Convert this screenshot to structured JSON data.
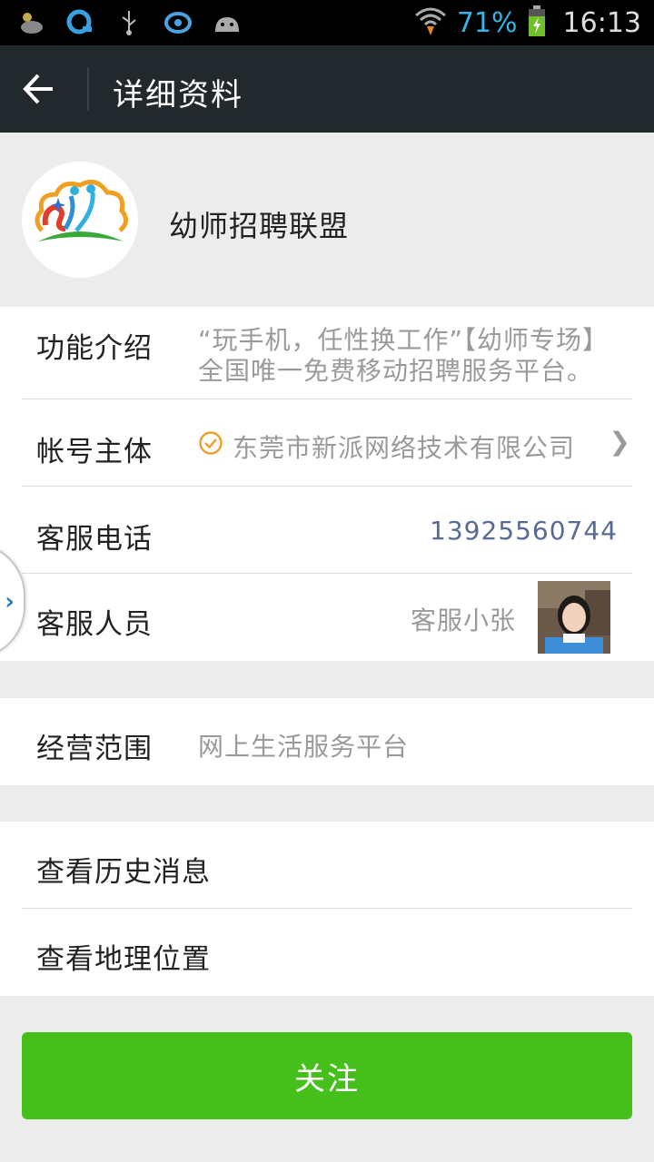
{
  "status_bar": {
    "icons": [
      "weather-icon",
      "q-app-icon",
      "usb-icon",
      "eye-app-icon",
      "android-icon",
      "wifi-icon",
      "battery-icon"
    ],
    "battery_percent": "71%",
    "time": "16:13",
    "battery_color": "#33b5e5"
  },
  "action_bar": {
    "title": "详细资料"
  },
  "profile": {
    "name": "幼师招聘联盟"
  },
  "details": {
    "intro_label": "功能介绍",
    "intro_value": "“玩手机，任性换工作”【幼师专场】全国唯一免费移动招聘服务平台。",
    "owner_label": "帐号主体",
    "owner_value": "东莞市新派网络技术有限公司",
    "phone_label": "客服电话",
    "phone_value": "13925560744",
    "staff_label": "客服人员",
    "staff_value": "客服小张",
    "link_color": "#576b95"
  },
  "scope": {
    "label": "经营范围",
    "value": "网上生活服务平台"
  },
  "links": {
    "history": "查看历史消息",
    "location": "查看地理位置"
  },
  "follow_button": {
    "label": "关注",
    "color": "#45c01a"
  }
}
